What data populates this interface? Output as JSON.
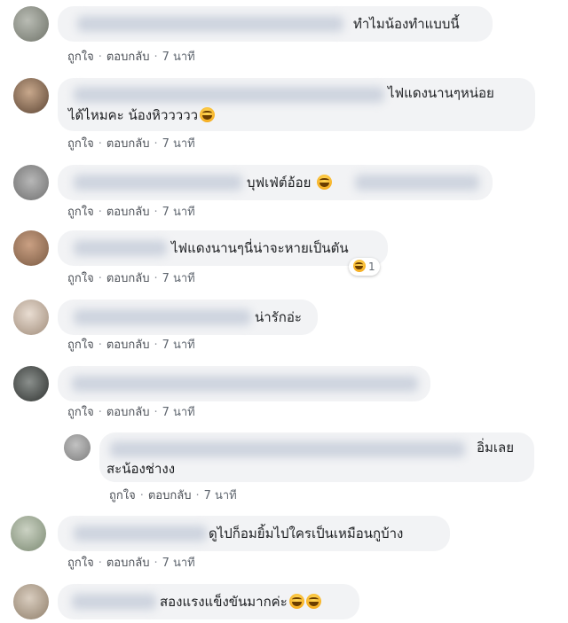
{
  "colors": {
    "bubble": "#f2f3f5",
    "meta": "#606770",
    "text": "#1c1e21"
  },
  "action_labels": {
    "like": "ถูกใจ",
    "reply": "ตอบกลับ",
    "separator": "·"
  },
  "comments": [
    {
      "text": "ทำไมน้องทำแบบนี้",
      "time": "7 นาที"
    },
    {
      "text": "ไฟแดงนานๆหน่อย",
      "text2": "ได้ไหมคะ น้องหิววววว",
      "time": "7 นาที"
    },
    {
      "text": "บุฟเฟ่ต์อ้อย",
      "time": "7 นาที"
    },
    {
      "text": "ไฟแดงนานๆนี่น่าจะหายเป็นตัน",
      "time": "7 นาที",
      "reaction_count": "1"
    },
    {
      "text": "น่ารักอ่ะ",
      "time": "7 นาที"
    },
    {
      "text": "",
      "time": "7 นาที"
    },
    {
      "text": "อิ่มเลย",
      "text2": "สะน้องช่างง",
      "time": "7 นาที",
      "reply": true
    },
    {
      "text": "ดูไปก็อมยิ้มไปใครเป็นเหมือนกูบ้าง",
      "time": "7 นาที"
    },
    {
      "text": "สองแรงแข็งขันมากค่ะ",
      "time": ""
    }
  ]
}
